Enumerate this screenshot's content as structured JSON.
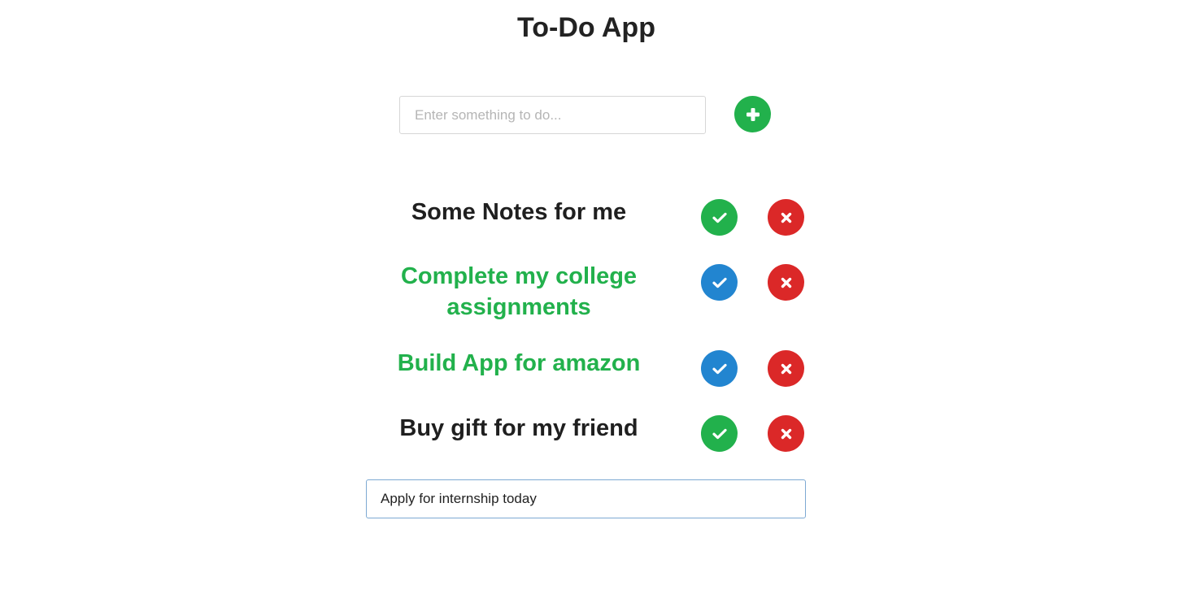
{
  "app": {
    "title": "To-Do App"
  },
  "new_todo": {
    "placeholder": "Enter something to do...",
    "value": "",
    "add_icon": "plus-icon",
    "add_color": "#22b14c"
  },
  "colors": {
    "completed_text": "#22b14c",
    "pending_text": "#1f1f1f",
    "done_pending": "#22b14c",
    "done_completed": "#2285d0",
    "delete": "#db2828"
  },
  "todos": [
    {
      "text": "Some Notes for me",
      "completed": false,
      "done_icon": "check-icon",
      "delete_icon": "times-icon"
    },
    {
      "text": "Complete my college assignments",
      "completed": true,
      "done_icon": "check-icon",
      "delete_icon": "times-icon"
    },
    {
      "text": "Build App for amazon",
      "completed": true,
      "done_icon": "check-icon",
      "delete_icon": "times-icon"
    },
    {
      "text": "Buy gift for my friend",
      "completed": false,
      "done_icon": "check-icon",
      "delete_icon": "times-icon"
    }
  ],
  "edit_todo": {
    "value": "Apply for internship today"
  }
}
